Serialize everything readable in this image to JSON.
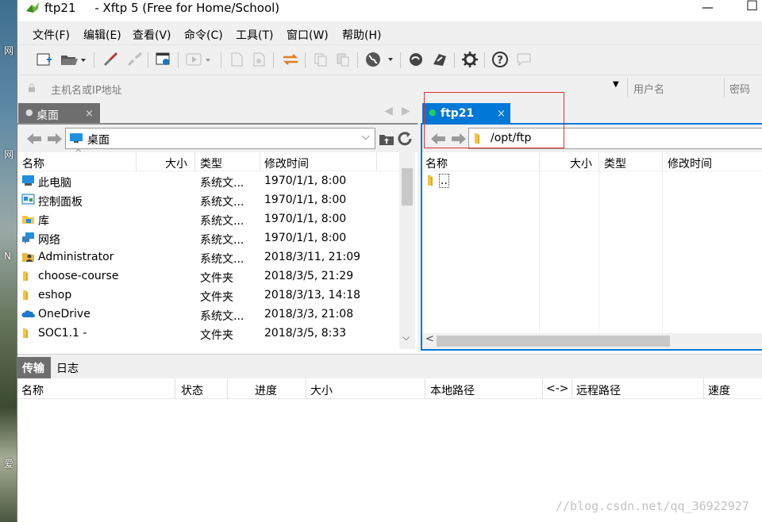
{
  "desktop": {
    "labels": [
      "网",
      "网",
      "N",
      "爱"
    ]
  },
  "window": {
    "title": "ftp21     - Xftp 5 (Free for Home/School)",
    "minimize": "—",
    "maximize": "☐"
  },
  "menu": [
    "文件(F)",
    "编辑(E)",
    "查看(V)",
    "命令(C)",
    "工具(T)",
    "窗口(W)",
    "帮助(H)"
  ],
  "address": {
    "host_placeholder": "主机名或IP地址",
    "user_placeholder": "用户名",
    "password_placeholder": "密码"
  },
  "local": {
    "tab_label": "桌面",
    "path": "桌面",
    "columns": [
      "名称",
      "大小",
      "类型",
      "修改时间"
    ],
    "rows": [
      {
        "name": "此电脑",
        "size": "",
        "type": "系统文...",
        "modified": "1970/1/1, 8:00",
        "icon": "computer-icon"
      },
      {
        "name": "控制面板",
        "size": "",
        "type": "系统文...",
        "modified": "1970/1/1, 8:00",
        "icon": "control-panel-icon"
      },
      {
        "name": "库",
        "size": "",
        "type": "系统文...",
        "modified": "1970/1/1, 8:00",
        "icon": "library-icon"
      },
      {
        "name": "网络",
        "size": "",
        "type": "系统文...",
        "modified": "1970/1/1, 8:00",
        "icon": "network-icon"
      },
      {
        "name": "Administrator",
        "size": "",
        "type": "系统文...",
        "modified": "2018/3/11, 21:09",
        "icon": "user-folder-icon"
      },
      {
        "name": "choose-course",
        "size": "",
        "type": "文件夹",
        "modified": "2018/3/5, 21:29",
        "icon": "folder-icon"
      },
      {
        "name": "eshop",
        "size": "",
        "type": "文件夹",
        "modified": "2018/3/13, 14:18",
        "icon": "folder-icon"
      },
      {
        "name": "OneDrive",
        "size": "",
        "type": "系统文...",
        "modified": "2018/3/3, 21:08",
        "icon": "onedrive-icon"
      },
      {
        "name": "SOC1.1 -",
        "size": "",
        "type": "文件夹",
        "modified": "2018/3/5, 8:33",
        "icon": "folder-icon"
      }
    ]
  },
  "remote": {
    "tab_label": "ftp21",
    "path": "/opt/ftp",
    "columns": [
      "名称",
      "大小",
      "类型",
      "修改时间"
    ],
    "rows": [
      {
        "name": "..",
        "icon": "folder-icon"
      }
    ]
  },
  "transfer": {
    "tabs": [
      "传输",
      "日志"
    ],
    "columns": [
      "名称",
      "状态",
      "进度",
      "大小",
      "本地路径",
      "<->",
      "远程路径",
      "速度"
    ]
  },
  "watermark": "//blog.csdn.net/qq_36922927",
  "colors": {
    "accent": "#0078d7",
    "highlight": "#e03030"
  }
}
